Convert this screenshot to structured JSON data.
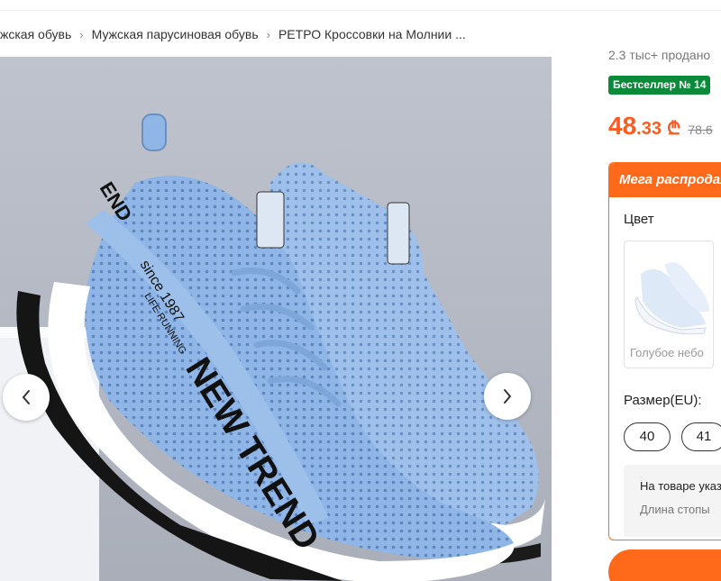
{
  "breadcrumb": {
    "items": [
      "жская обувь",
      "Мужская парусиновая обувь",
      "РЕТРО Кроссовки на Молнии ..."
    ]
  },
  "gallery": {
    "prev_label": "‹",
    "next_label": "›",
    "shoe_text": {
      "brand_strap": "NEW TREND",
      "since": "since 1987",
      "running": "LIFE RUNNING",
      "end": "END"
    }
  },
  "product": {
    "sold": "2.3 тыс+ продано",
    "badge": "Бестселлер № 14",
    "price_whole": "48",
    "price_cents": ".33",
    "currency": "₾",
    "old_price": "78.6"
  },
  "promo": {
    "title": "Мега распродажа",
    "color_label": "Цвет",
    "color_option": "Голубое небо",
    "size_label": "Размер(EU):",
    "sizes": [
      "40",
      "41"
    ],
    "note_line1": "На товаре указан",
    "note_line2": "Длина стопы"
  },
  "colors": {
    "accent": "#ff6a1a",
    "price": "#ff5a1f",
    "badge": "#0b8a3a",
    "shoe_knit": "#8fb6e6"
  }
}
